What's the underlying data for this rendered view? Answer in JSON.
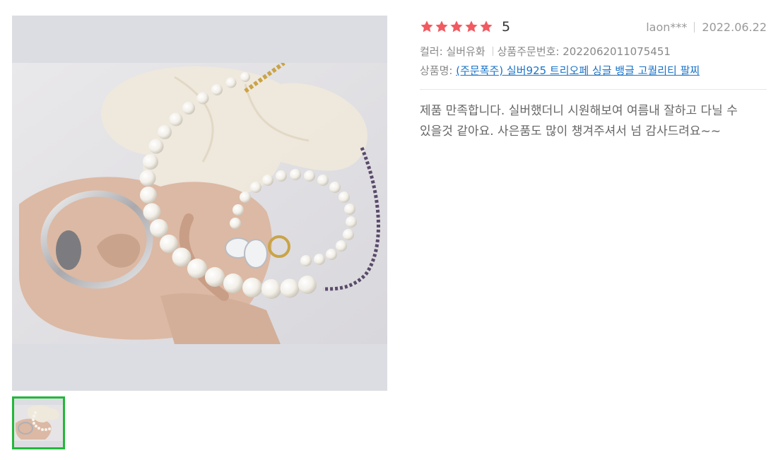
{
  "review": {
    "rating": {
      "stars": 5,
      "max_stars": 5,
      "score_text": "5",
      "star_color": "#f25a61"
    },
    "author": "laon***",
    "date": "2022.06.22",
    "options": {
      "color_label": "컬러: 실버유화",
      "order_number_label": "상품주문번호: 2022062011075451"
    },
    "product": {
      "prefix": "상품명:",
      "name": "(주문폭주) 실버925 트리오페 싱글 뱅글 고퀄리티 팔찌"
    },
    "content": "제품 만족합니다. 실버했더니 시원해보여 여름내 잘하고 다닐 수 있을것 같아요. 사은품도 많이 챙겨주셔서 넘 감사드려요~~"
  },
  "gallery": {
    "frame_color": "#dcdde2",
    "selected_border_color": "#22b83a",
    "thumbnail_count": 1,
    "selected_index": 0
  }
}
